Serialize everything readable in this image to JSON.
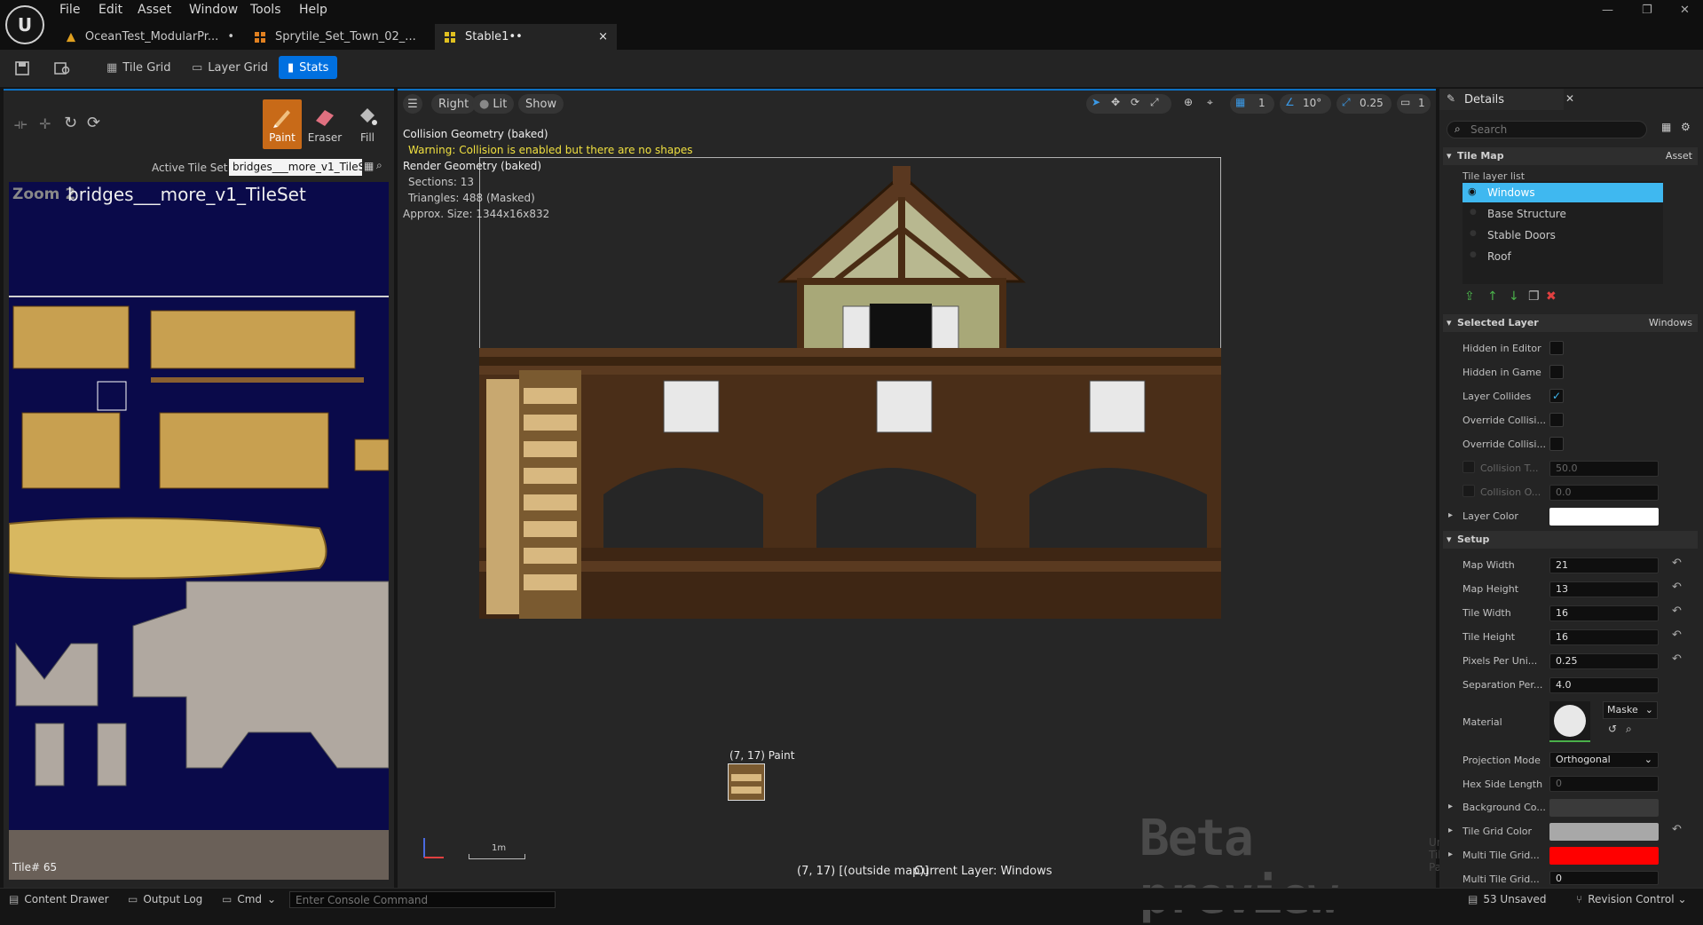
{
  "menu": [
    "File",
    "Edit",
    "Asset",
    "Window",
    "Tools",
    "Help"
  ],
  "tabs": [
    {
      "label": "OceanTest_ModularPr...",
      "dot": "•"
    },
    {
      "label": "Sprytile_Set_Town_02_..."
    },
    {
      "label": "Stable1••",
      "close": "×"
    }
  ],
  "window_controls": {
    "min": "—",
    "max": "❐",
    "close": "✕"
  },
  "toolbar": {
    "tile_grid": "Tile Grid",
    "layer_grid": "Layer Grid",
    "stats": "Stats"
  },
  "palette": {
    "tools": [
      "Paint",
      "Eraser",
      "Fill"
    ],
    "active_tile_set_label": "Active Tile Set",
    "active_tile_set_value": "bridges___more_v1_TileSet",
    "zoom_label": "Zoom 2",
    "tileset_name": "bridges___more_v1_TileSet",
    "tile_index": "Tile# 65"
  },
  "viewport": {
    "view_mode": "Right",
    "lit": "Lit",
    "show": "Show",
    "grid_value": "1",
    "angle_value": "10°",
    "scale_value": "0.25",
    "camera_value": "1",
    "stats": {
      "collision_title": "Collision Geometry (baked)",
      "warning": "Warning: Collision is enabled but there are no shapes",
      "render_title": "Render Geometry (baked)",
      "sections": "Sections: 13",
      "triangles": "Triangles: 488 (Masked)",
      "size": "Approx. Size: 1344x16x832"
    },
    "cursor_label": "(7, 17) Paint",
    "scale_bar": "1m",
    "status": "(7, 17) [(outside map)]",
    "current_layer": "Current Layer: Windows",
    "watermark": "Beta preview",
    "undo_hint": "Undo: Tile Painting"
  },
  "details": {
    "title": "Details",
    "search_placeholder": "Search",
    "tile_map_section": "Tile Map",
    "asset_label": "Asset",
    "layer_list_label": "Tile layer list",
    "layers": [
      "Windows",
      "Base Structure",
      "Stable Doors",
      "Roof"
    ],
    "selected_layer_section": "Selected Layer",
    "selected_layer_value": "Windows",
    "props": {
      "hidden_editor": "Hidden in Editor",
      "hidden_game": "Hidden in Game",
      "layer_collides": "Layer Collides",
      "override_1": "Override Collisi...",
      "override_2": "Override Collisi...",
      "collision_t": "Collision T...",
      "collision_t_val": "50.0",
      "collision_o": "Collision O...",
      "collision_o_val": "0.0",
      "layer_color": "Layer Color"
    },
    "setup_section": "Setup",
    "setup": {
      "map_width": "Map Width",
      "map_width_val": "21",
      "map_height": "Map Height",
      "map_height_val": "13",
      "tile_width": "Tile Width",
      "tile_width_val": "16",
      "tile_height": "Tile Height",
      "tile_height_val": "16",
      "ppu": "Pixels Per Uni...",
      "ppu_val": "0.25",
      "sep": "Separation Per...",
      "sep_val": "4.0",
      "material": "Material",
      "material_val": "Maske",
      "proj": "Projection Mode",
      "proj_val": "Orthogonal",
      "hex": "Hex Side Length",
      "hex_val": "0",
      "bg_color": "Background Co...",
      "grid_color": "Tile Grid Color",
      "multi_grid": "Multi Tile Grid...",
      "multi_grid2": "Multi Tile Grid...",
      "multi_grid2_val": "0"
    }
  },
  "statusbar": {
    "content_drawer": "Content Drawer",
    "output_log": "Output Log",
    "cmd": "Cmd",
    "console_placeholder": "Enter Console Command",
    "unsaved": "53 Unsaved",
    "revision": "Revision Control"
  },
  "colors": {
    "accent": "#0070e0",
    "warning": "#f0e040",
    "layer_sel": "#3fb8f0",
    "tool_active": "#c86a18"
  }
}
